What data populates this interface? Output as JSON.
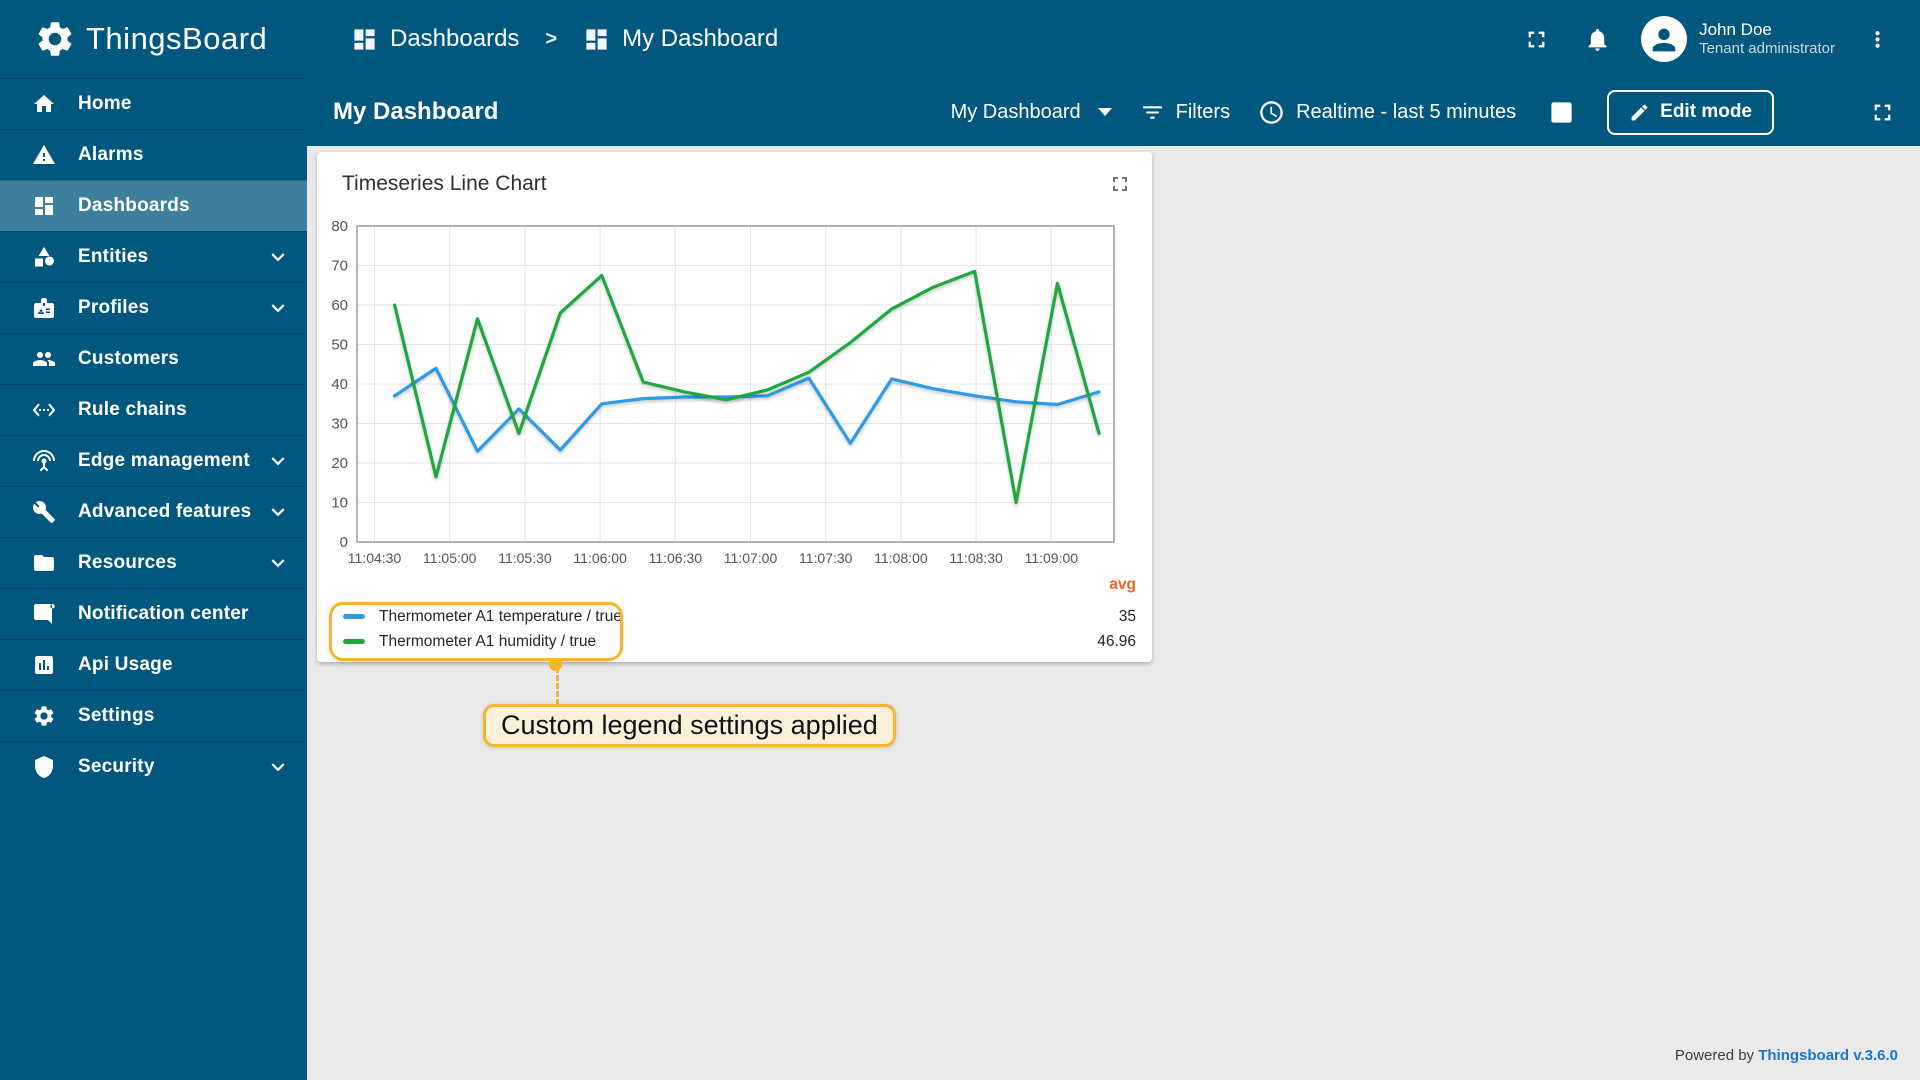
{
  "app": {
    "name": "ThingsBoard",
    "footer_prefix": "Powered by",
    "footer_link": "Thingsboard v.3.6.0"
  },
  "header": {
    "breadcrumb": [
      {
        "label": "Dashboards",
        "icon": "dashboard"
      },
      {
        "label": "My Dashboard",
        "icon": "dashboard"
      }
    ],
    "separator": ">",
    "user": {
      "name": "John Doe",
      "role": "Tenant administrator"
    }
  },
  "toolbar": {
    "title": "My Dashboard",
    "dashboard_select": "My Dashboard",
    "filters_label": "Filters",
    "timewindow": "Realtime - last 5 minutes",
    "edit_mode_label": "Edit mode"
  },
  "sidebar": {
    "items": [
      {
        "label": "Home",
        "icon": "home",
        "selected": false,
        "expandable": false
      },
      {
        "label": "Alarms",
        "icon": "warning",
        "selected": false,
        "expandable": false
      },
      {
        "label": "Dashboards",
        "icon": "dashboard",
        "selected": true,
        "expandable": false
      },
      {
        "label": "Entities",
        "icon": "category",
        "selected": false,
        "expandable": true
      },
      {
        "label": "Profiles",
        "icon": "badge",
        "selected": false,
        "expandable": true
      },
      {
        "label": "Customers",
        "icon": "group",
        "selected": false,
        "expandable": false
      },
      {
        "label": "Rule chains",
        "icon": "ethernet",
        "selected": false,
        "expandable": false
      },
      {
        "label": "Edge management",
        "icon": "antenna",
        "selected": false,
        "expandable": true
      },
      {
        "label": "Advanced features",
        "icon": "tools",
        "selected": false,
        "expandable": true
      },
      {
        "label": "Resources",
        "icon": "folder",
        "selected": false,
        "expandable": true
      },
      {
        "label": "Notification center",
        "icon": "message",
        "selected": false,
        "expandable": false
      },
      {
        "label": "Api Usage",
        "icon": "chart-box",
        "selected": false,
        "expandable": false
      },
      {
        "label": "Settings",
        "icon": "gear",
        "selected": false,
        "expandable": false
      },
      {
        "label": "Security",
        "icon": "shield",
        "selected": false,
        "expandable": true
      }
    ]
  },
  "widget": {
    "title": "Timeseries Line Chart"
  },
  "annotation": {
    "text": "Custom legend settings applied",
    "highlight_color": "#f7b42c",
    "annotation_bg": "#fcf0da"
  },
  "chart_data": {
    "type": "line",
    "title": "Timeseries Line Chart",
    "xlabel": "",
    "ylabel": "",
    "ylim": [
      0,
      80
    ],
    "y_ticks": [
      0,
      10,
      20,
      30,
      40,
      50,
      60,
      70,
      80
    ],
    "x_ticks": [
      "11:04:30",
      "11:05:00",
      "11:05:30",
      "11:06:00",
      "11:06:30",
      "11:07:00",
      "11:07:30",
      "11:08:00",
      "11:08:30",
      "11:09:00"
    ],
    "grid": true,
    "legend_position": "bottom",
    "avg_label": "avg",
    "series": [
      {
        "name": "Thermometer A1 temperature / true",
        "color": "#2e9be6",
        "avg": "35",
        "values": [
          37,
          44,
          23,
          33.7,
          23.3,
          35,
          36.3,
          36.7,
          36.7,
          37,
          41.5,
          25,
          41.3,
          38.8,
          37,
          35.5,
          34.8,
          38
        ]
      },
      {
        "name": "Thermometer A1 humidity / true",
        "color": "#1fa83d",
        "avg": "46.96",
        "values": [
          60,
          16.5,
          56.5,
          27.5,
          58,
          67.5,
          40.5,
          38,
          36,
          38.5,
          43,
          50.5,
          59,
          64.5,
          68.5,
          10,
          65.5,
          27.5
        ]
      }
    ]
  }
}
